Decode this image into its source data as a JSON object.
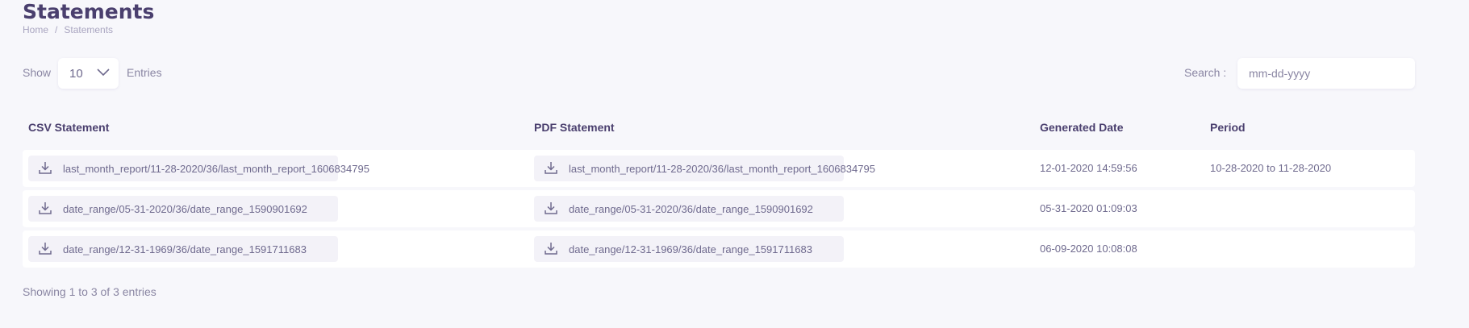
{
  "header": {
    "title": "Statements",
    "breadcrumb": {
      "home": "Home",
      "separator": "/",
      "current": "Statements"
    }
  },
  "controls": {
    "show_label": "Show",
    "entries_value": "10",
    "entries_label": "Entries",
    "search_label": "Search :",
    "search_placeholder": "mm-dd-yyyy"
  },
  "table": {
    "columns": {
      "csv": "CSV Statement",
      "pdf": "PDF Statement",
      "date": "Generated Date",
      "period": "Period"
    },
    "rows": [
      {
        "csv": "last_month_report/11-28-2020/36/last_month_report_1606834795",
        "pdf": "last_month_report/11-28-2020/36/last_month_report_1606834795",
        "date": "12-01-2020 14:59:56",
        "period": "10-28-2020 to 11-28-2020"
      },
      {
        "csv": "date_range/05-31-2020/36/date_range_1590901692",
        "pdf": "date_range/05-31-2020/36/date_range_1590901692",
        "date": "05-31-2020 01:09:03",
        "period": ""
      },
      {
        "csv": "date_range/12-31-1969/36/date_range_1591711683",
        "pdf": "date_range/12-31-1969/36/date_range_1591711683",
        "date": "06-09-2020 10:08:08",
        "period": ""
      }
    ]
  },
  "footer": {
    "info": "Showing 1 to 3 of 3 entries"
  },
  "icons": {
    "download": "download-icon",
    "chevron": "chevron-down-icon"
  },
  "colors": {
    "background": "#f7f7fb",
    "heading": "#4a3f6e",
    "text": "#6f6a8e",
    "muted": "#a9a5c0",
    "download_chip": "#f3f2f8"
  }
}
